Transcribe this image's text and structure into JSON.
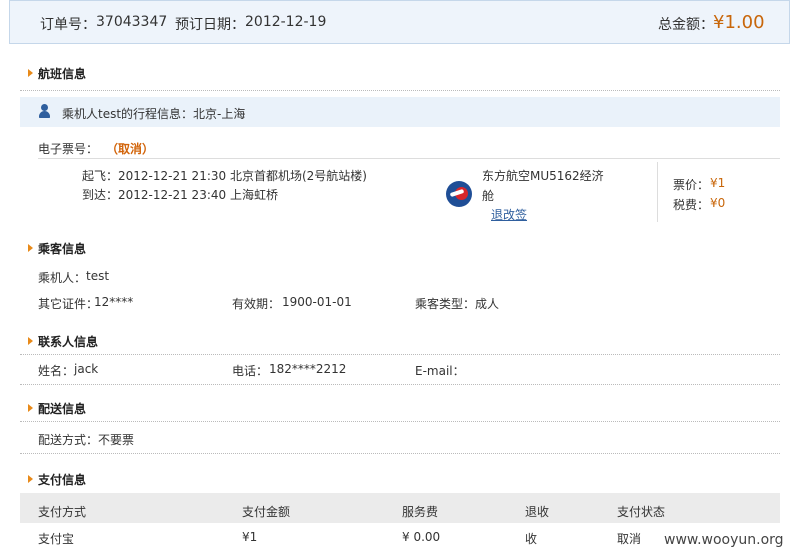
{
  "header": {
    "order_no_label": "订单号：",
    "order_no": "37043347",
    "booking_date_label": "预订日期：",
    "booking_date": "2012-12-19",
    "total_label": "总金额：",
    "total_amount": "¥1.00"
  },
  "flight_section": {
    "title": "航班信息",
    "trip_info": "乘机人test的行程信息：北京-上海",
    "eticket_label": "电子票号：",
    "eticket_status": "（取消）",
    "depart_label": "起飞：",
    "depart_value": "2012-12-21 21:30 北京首都机场(2号航站楼)",
    "arrive_label": "到达：",
    "arrive_value": "2012-12-21 23:40 上海虹桥",
    "airline_line1": "东方航空MU5162经济",
    "airline_line2": "舱",
    "change_link": "退改签",
    "fare_label": "票价：",
    "fare_value": "¥1",
    "tax_label": "税费：",
    "tax_value": "¥0"
  },
  "passenger_section": {
    "title": "乘客信息",
    "passenger_label": "乘机人：",
    "passenger_name": "test",
    "id_label": "其它证件：",
    "id_value": "12****",
    "validity_label": "有效期：",
    "validity_value": "1900-01-01",
    "type_label": "乘客类型：",
    "type_value": "成人"
  },
  "contact_section": {
    "title": "联系人信息",
    "name_label": "姓名：",
    "name_value": "jack",
    "phone_label": "电话：",
    "phone_value": "182****2212",
    "email_label": "E-mail：",
    "email_value": ""
  },
  "delivery_section": {
    "title": "配送信息",
    "method_label": "配送方式：",
    "method_value": "不要票"
  },
  "payment_section": {
    "title": "支付信息",
    "columns": [
      "支付方式",
      "支付金额",
      "服务费",
      "退收",
      "支付状态"
    ],
    "rows": [
      [
        "支付宝",
        "¥1",
        "¥ 0.00",
        "收",
        "取消"
      ]
    ]
  },
  "watermark": "www.wooyun.org",
  "colors": {
    "accent_orange": "#c8660a",
    "header_bg": "#eef4fb",
    "link_blue": "#2f5f9e"
  },
  "icons": [
    "section-arrow-icon",
    "user-icon",
    "airline-logo-icon"
  ]
}
